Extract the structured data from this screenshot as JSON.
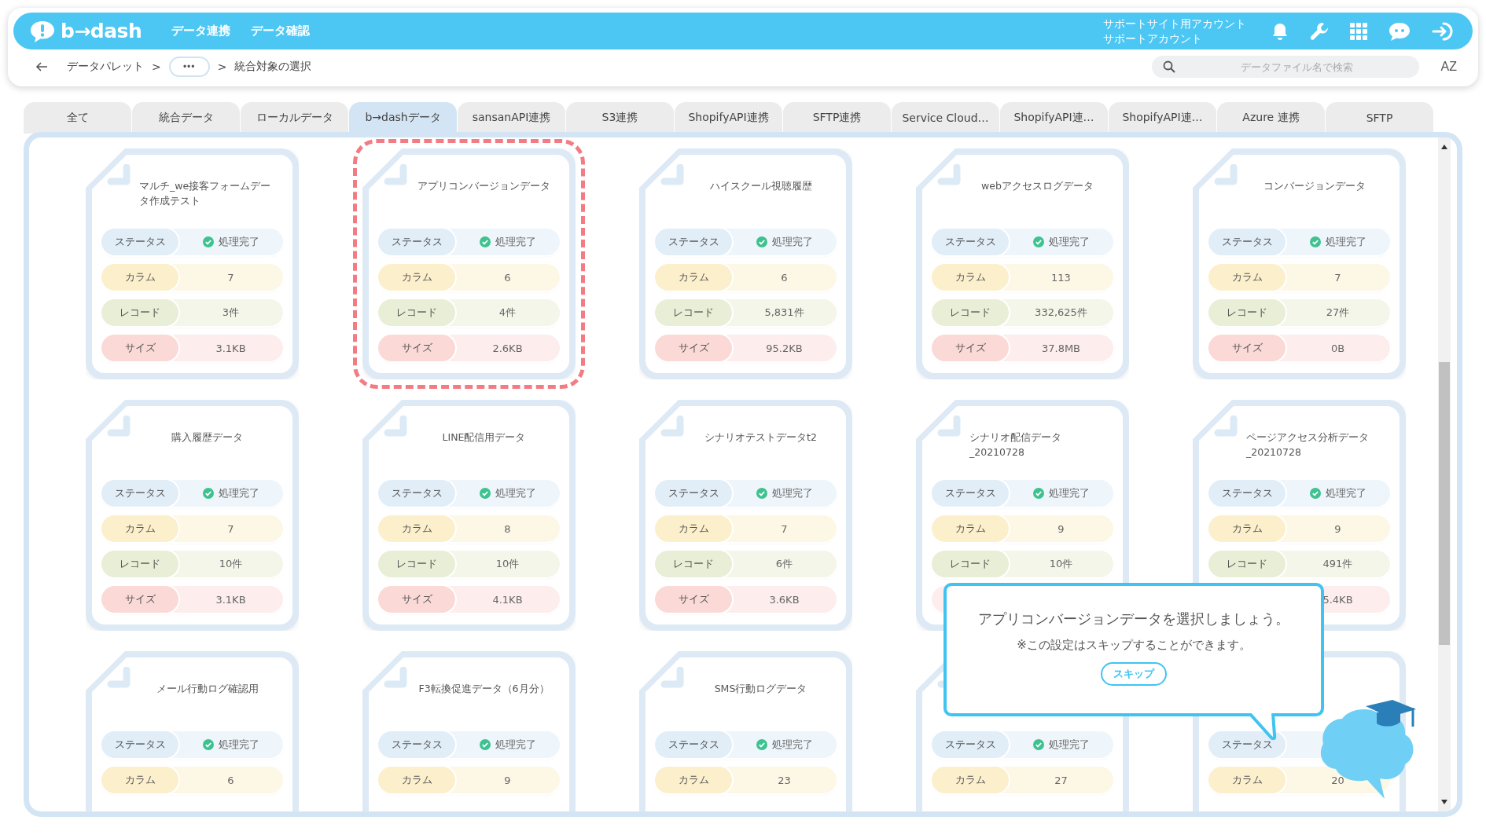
{
  "header": {
    "logo": "b→dash",
    "nav": [
      {
        "label": "データ連携"
      },
      {
        "label": "データ確認"
      }
    ],
    "account": [
      "サポートサイト用アカウント",
      "サポートアカウント"
    ]
  },
  "breadcrumb": [
    {
      "kind": "link",
      "label": "データパレット"
    },
    {
      "kind": "sep",
      "label": ">"
    },
    {
      "kind": "more",
      "label": "•••"
    },
    {
      "kind": "sep",
      "label": ">"
    },
    {
      "kind": "current",
      "label": "統合対象の選択"
    }
  ],
  "search": {
    "placeholder": "データファイル名で検索"
  },
  "sort_label": "AZ",
  "tabs": [
    {
      "label": "全て",
      "selected": false
    },
    {
      "label": "統合データ",
      "selected": false
    },
    {
      "label": "ローカルデータ",
      "selected": false
    },
    {
      "label": "b→dashデータ",
      "selected": true
    },
    {
      "label": "sansanAPI連携",
      "selected": false
    },
    {
      "label": "S3連携",
      "selected": false
    },
    {
      "label": "ShopifyAPI連携",
      "selected": false
    },
    {
      "label": "SFTP連携",
      "selected": false
    },
    {
      "label": "Service Cloud…",
      "selected": false
    },
    {
      "label": "ShopifyAPI連…",
      "selected": false
    },
    {
      "label": "ShopifyAPI連…",
      "selected": false
    },
    {
      "label": "Azure 連携",
      "selected": false
    },
    {
      "label": "SFTP",
      "selected": false
    }
  ],
  "cards": [
    {
      "title": "マルチ_we接客フォームデータ作成テスト",
      "highlighted": false,
      "rows": [
        {
          "kind": "status",
          "label": "ステータス",
          "value": "処理完了"
        },
        {
          "kind": "columns",
          "label": "カラム",
          "value": "7"
        },
        {
          "kind": "records",
          "label": "レコード",
          "value": "3件"
        },
        {
          "kind": "size",
          "label": "サイズ",
          "value": "3.1KB"
        }
      ]
    },
    {
      "title": "アプリコンバージョンデータ",
      "highlighted": true,
      "rows": [
        {
          "kind": "status",
          "label": "ステータス",
          "value": "処理完了"
        },
        {
          "kind": "columns",
          "label": "カラム",
          "value": "6"
        },
        {
          "kind": "records",
          "label": "レコード",
          "value": "4件"
        },
        {
          "kind": "size",
          "label": "サイズ",
          "value": "2.6KB"
        }
      ]
    },
    {
      "title": "ハイスクール視聴履歴",
      "highlighted": false,
      "rows": [
        {
          "kind": "status",
          "label": "ステータス",
          "value": "処理完了"
        },
        {
          "kind": "columns",
          "label": "カラム",
          "value": "6"
        },
        {
          "kind": "records",
          "label": "レコード",
          "value": "5,831件"
        },
        {
          "kind": "size",
          "label": "サイズ",
          "value": "95.2KB"
        }
      ]
    },
    {
      "title": "webアクセスログデータ",
      "highlighted": false,
      "rows": [
        {
          "kind": "status",
          "label": "ステータス",
          "value": "処理完了"
        },
        {
          "kind": "columns",
          "label": "カラム",
          "value": "113"
        },
        {
          "kind": "records",
          "label": "レコード",
          "value": "332,625件"
        },
        {
          "kind": "size",
          "label": "サイズ",
          "value": "37.8MB"
        }
      ]
    },
    {
      "title": "コンバージョンデータ",
      "highlighted": false,
      "rows": [
        {
          "kind": "status",
          "label": "ステータス",
          "value": "処理完了"
        },
        {
          "kind": "columns",
          "label": "カラム",
          "value": "7"
        },
        {
          "kind": "records",
          "label": "レコード",
          "value": "27件"
        },
        {
          "kind": "size",
          "label": "サイズ",
          "value": "0B"
        }
      ]
    },
    {
      "title": "購入履歴データ",
      "highlighted": false,
      "rows": [
        {
          "kind": "status",
          "label": "ステータス",
          "value": "処理完了"
        },
        {
          "kind": "columns",
          "label": "カラム",
          "value": "7"
        },
        {
          "kind": "records",
          "label": "レコード",
          "value": "10件"
        },
        {
          "kind": "size",
          "label": "サイズ",
          "value": "3.1KB"
        }
      ]
    },
    {
      "title": "LINE配信用データ",
      "highlighted": false,
      "rows": [
        {
          "kind": "status",
          "label": "ステータス",
          "value": "処理完了"
        },
        {
          "kind": "columns",
          "label": "カラム",
          "value": "8"
        },
        {
          "kind": "records",
          "label": "レコード",
          "value": "10件"
        },
        {
          "kind": "size",
          "label": "サイズ",
          "value": "4.1KB"
        }
      ]
    },
    {
      "title": "シナリオテストデータt2",
      "highlighted": false,
      "rows": [
        {
          "kind": "status",
          "label": "ステータス",
          "value": "処理完了"
        },
        {
          "kind": "columns",
          "label": "カラム",
          "value": "7"
        },
        {
          "kind": "records",
          "label": "レコード",
          "value": "6件"
        },
        {
          "kind": "size",
          "label": "サイズ",
          "value": "3.6KB"
        }
      ]
    },
    {
      "title": "シナリオ配信データ_20210728",
      "highlighted": false,
      "rows": [
        {
          "kind": "status",
          "label": "ステータス",
          "value": "処理完了"
        },
        {
          "kind": "columns",
          "label": "カラム",
          "value": "9"
        },
        {
          "kind": "records",
          "label": "レコード",
          "value": "10件"
        },
        {
          "kind": "size"
        }
      ]
    },
    {
      "title": "ページアクセス分析データ_20210728",
      "highlighted": false,
      "rows": [
        {
          "kind": "status",
          "label": "ステータス",
          "value": "処理完了"
        },
        {
          "kind": "columns",
          "label": "カラム",
          "value": "9"
        },
        {
          "kind": "records",
          "label": "レコード",
          "value": "491件"
        },
        {
          "kind": "size",
          "value": "5.4KB"
        }
      ]
    },
    {
      "title": "メール行動ログ確認用",
      "highlighted": false,
      "rows": [
        {
          "kind": "status",
          "label": "ステータス",
          "value": "処理完了"
        },
        {
          "kind": "columns",
          "label": "カラム",
          "value": "6"
        }
      ]
    },
    {
      "title": "F3転換促進データ（6月分）",
      "highlighted": false,
      "rows": [
        {
          "kind": "status",
          "label": "ステータス",
          "value": "処理完了"
        },
        {
          "kind": "columns",
          "label": "カラム",
          "value": "9"
        }
      ]
    },
    {
      "title": "SMS行動ログデータ",
      "highlighted": false,
      "rows": [
        {
          "kind": "status",
          "label": "ステータス",
          "value": "処理完了"
        },
        {
          "kind": "columns",
          "label": "カラム",
          "value": "23"
        }
      ]
    },
    {
      "highlighted": false,
      "rows": [
        {
          "kind": "status",
          "label": "ステータス",
          "value": "処理完了"
        },
        {
          "kind": "columns",
          "label": "カラム",
          "value": "27"
        }
      ]
    },
    {
      "highlighted": false,
      "rows": [
        {
          "kind": "status",
          "label": "ステータス"
        },
        {
          "kind": "columns",
          "label": "カラム",
          "value": "20"
        }
      ]
    }
  ],
  "tooltip": {
    "message": "アプリコンバージョンデータを選択しましょう。",
    "note": "※この設定はスキップすることができます。",
    "skip": "スキップ"
  }
}
